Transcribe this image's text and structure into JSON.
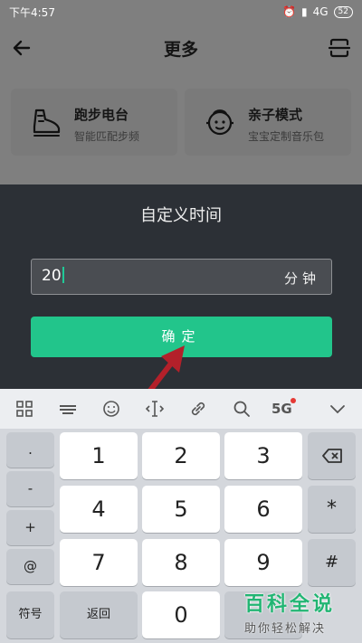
{
  "status_bar": {
    "time": "下午4:57",
    "network": "4G",
    "battery": "52"
  },
  "header": {
    "title": "更多"
  },
  "features": [
    {
      "title": "跑步电台",
      "subtitle": "智能匹配步频",
      "icon": "running-shoe-icon"
    },
    {
      "title": "亲子模式",
      "subtitle": "宝宝定制音乐包",
      "icon": "child-face-icon"
    }
  ],
  "dialog": {
    "title": "自定义时间",
    "input_value": "20",
    "unit": "分钟",
    "confirm_label": "确定"
  },
  "keyboard": {
    "toolbar_5g": "5G",
    "left_column": [
      ".",
      "-",
      "+",
      "@"
    ],
    "digits": [
      "1",
      "2",
      "3",
      "4",
      "5",
      "6",
      "7",
      "8",
      "9"
    ],
    "right_column": [
      "*",
      "#"
    ],
    "bottom": {
      "symbols": "符号",
      "back": "返回",
      "zero": "0"
    }
  },
  "watermark": {
    "title": "百科全说",
    "subtitle": "助你轻松解决"
  },
  "colors": {
    "accent": "#22c58b",
    "dialog_bg": "#2c3036",
    "arrow": "#b3202a"
  }
}
